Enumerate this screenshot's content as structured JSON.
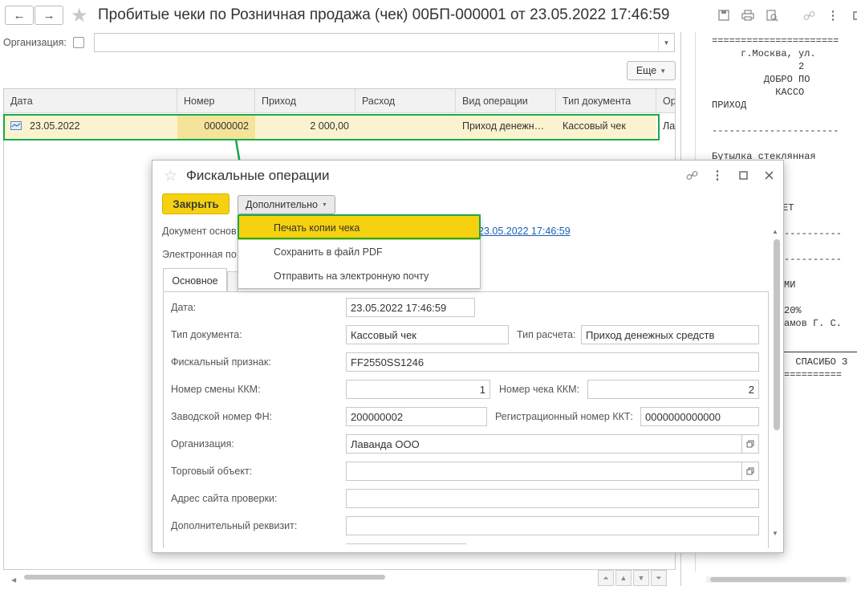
{
  "window": {
    "title": "Пробитые чеки по  Розничная продажа (чек) 00БП-000001 от 23.05.2022 17:46:59",
    "back_icon": "←",
    "forward_icon": "→",
    "star_icon": "★",
    "toolbar_icons": [
      "💾",
      "🖶",
      "🔍",
      "🔗",
      "⋮",
      "▢",
      "✕"
    ]
  },
  "filter": {
    "org_label": "Организация:",
    "org_value": "",
    "more_button": "Еще"
  },
  "table": {
    "columns": [
      "Дата",
      "Номер",
      "Приход",
      "Расход",
      "Вид операции",
      "Тип документа",
      "Ор"
    ],
    "row": {
      "date": "23.05.2022",
      "number": "00000002",
      "income": "2 000,00",
      "expense": "",
      "operation": "Приход денежн…",
      "doc_type": "Кассовый чек",
      "org": "Ла"
    }
  },
  "receipt": {
    "lines": [
      "======================",
      "     г.Москва, ул.",
      "               2",
      "         ДОБРО ПО",
      "           КАССО",
      "ПРИХОД",
      "----------------------",
      "Бутылка стеклянная",
      "ЕТ",
      "----------",
      "----------",
      "МИ",
      "20%",
      "амов Г. С.",
      "  СПАСИБО З",
      "=========="
    ]
  },
  "dialog": {
    "title": "Фискальные операции",
    "close_button": "Закрыть",
    "more_button": "Дополнительно",
    "doc_basis_label": "Документ основ",
    "doc_basis_link": "23.05.2022 17:46:59",
    "email_label": "Электронная по",
    "menu": [
      "Печать копии чека",
      "Сохранить в файл PDF",
      "Отправить на электронную почту"
    ],
    "tab_main": "Основное",
    "fields": {
      "date_label": "Дата:",
      "date_value": "23.05.2022 17:46:59",
      "doc_type_label": "Тип документа:",
      "doc_type_value": "Кассовый чек",
      "calc_type_label": "Тип расчета:",
      "calc_type_value": "Приход денежных средств",
      "fiscal_label": "Фискальный признак:",
      "fiscal_value": "FF2550SS1246",
      "shift_label": "Номер смены ККМ:",
      "shift_value": "1",
      "check_label": "Номер чека ККМ:",
      "check_value": "2",
      "fn_label": "Заводской номер ФН:",
      "fn_value": "200000002",
      "kkt_label": "Регистрационный номер ККТ:",
      "kkt_value": "0000000000000",
      "org_label": "Организация:",
      "org_value": "Лаванда ООО",
      "trade_label": "Торговый объект:",
      "trade_value": "",
      "site_label": "Адрес сайта проверки:",
      "site_value": "",
      "extra_label": "Дополнительный реквизит:",
      "extra_value": ""
    }
  },
  "colors": {
    "highlight_green": "#1aa84b",
    "button_yellow": "#f5d10f",
    "row_selected": "#fbf3d0",
    "link": "#1a5fb4"
  }
}
